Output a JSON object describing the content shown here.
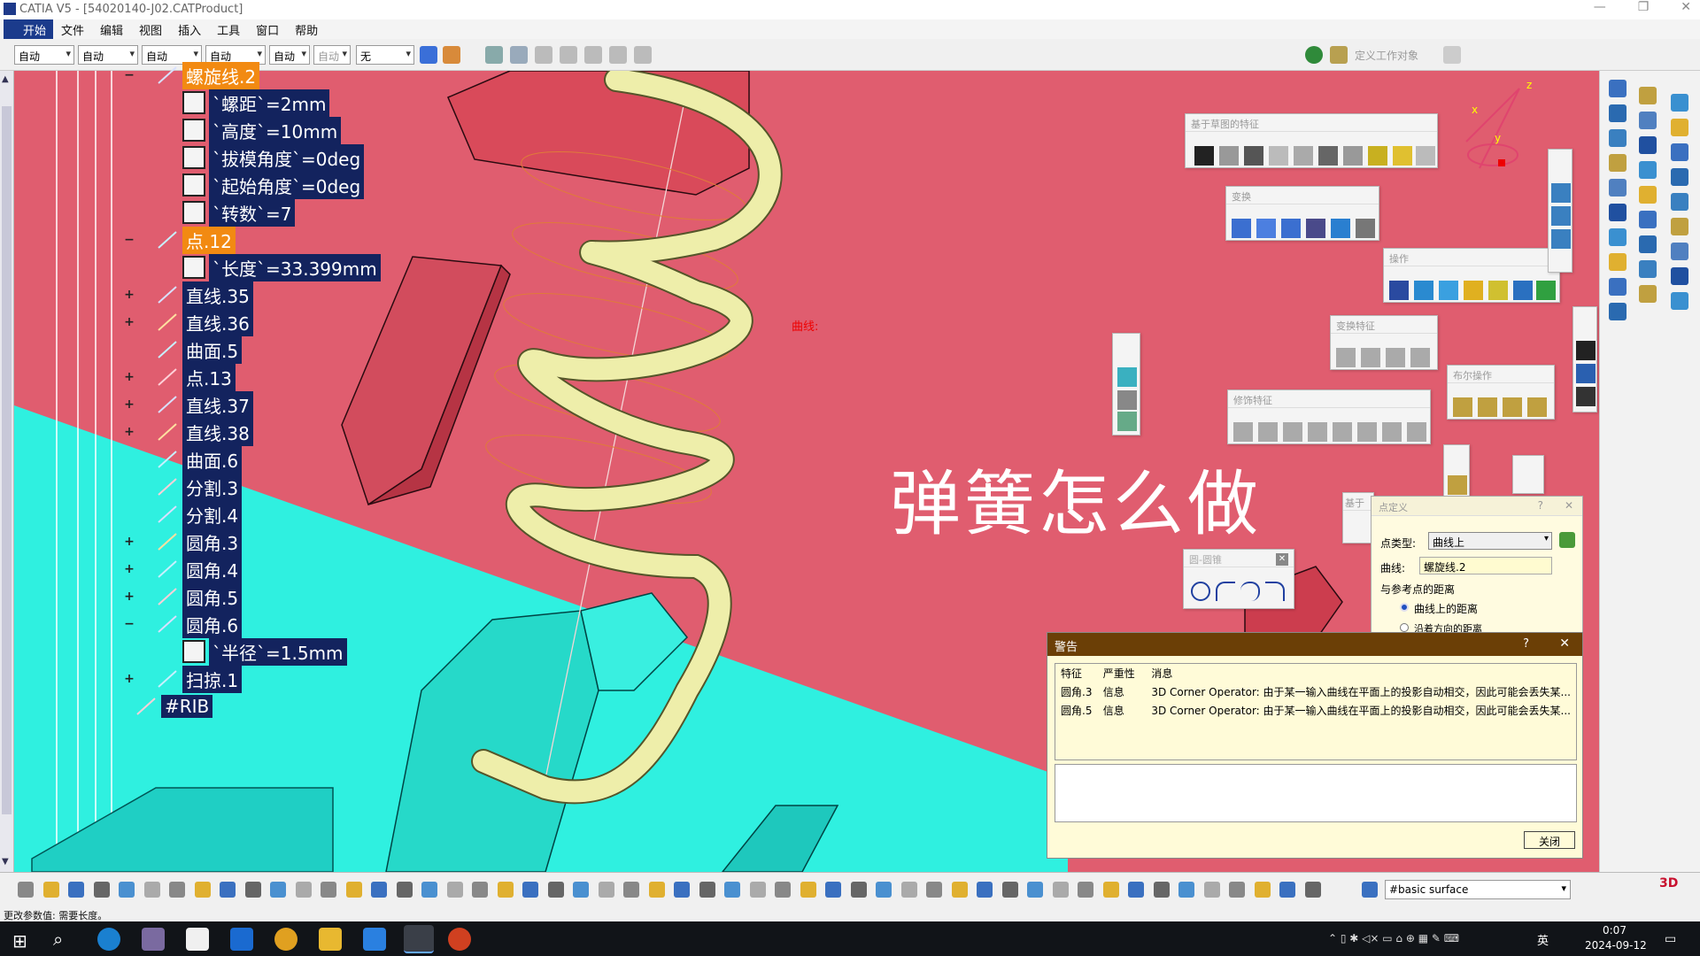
{
  "window": {
    "title": "CATIA V5 - [54020140-J02.CATProduct]",
    "controls": [
      "—",
      "❐",
      "✕"
    ]
  },
  "menu": [
    "开始",
    "文件",
    "编辑",
    "视图",
    "插入",
    "工具",
    "窗口",
    "帮助"
  ],
  "toolbar": {
    "combos": [
      "自动",
      "自动",
      "自动",
      "自动",
      "自动",
      "自动",
      "无"
    ],
    "define_work_object": "定义工作对象"
  },
  "tree": {
    "nodes": [
      {
        "label": "螺旋线.2",
        "expander": "−",
        "selected": true,
        "indent": 0
      },
      {
        "label": "`螺距`=2mm",
        "expander": "",
        "indent": 1
      },
      {
        "label": "`高度`=10mm",
        "expander": "",
        "indent": 1
      },
      {
        "label": "`拔模角度`=0deg",
        "expander": "",
        "indent": 1
      },
      {
        "label": "`起始角度`=0deg",
        "expander": "",
        "indent": 1
      },
      {
        "label": "`转数`=7",
        "expander": "",
        "indent": 1
      },
      {
        "label": "点.12",
        "expander": "−",
        "selected": true,
        "indent": 0
      },
      {
        "label": "`长度`=33.399mm",
        "expander": "",
        "indent": 1
      },
      {
        "label": "直线.35",
        "expander": "+",
        "indent": 0
      },
      {
        "label": "直线.36",
        "expander": "+",
        "indent": 0
      },
      {
        "label": "曲面.5",
        "expander": "",
        "indent": 0
      },
      {
        "label": "点.13",
        "expander": "+",
        "indent": 0
      },
      {
        "label": "直线.37",
        "expander": "+",
        "indent": 0
      },
      {
        "label": "直线.38",
        "expander": "+",
        "indent": 0
      },
      {
        "label": "曲面.6",
        "expander": "",
        "indent": 0
      },
      {
        "label": "分割.3",
        "expander": "",
        "indent": 0
      },
      {
        "label": "分割.4",
        "expander": "",
        "indent": 0
      },
      {
        "label": "圆角.3",
        "expander": "+",
        "indent": 0
      },
      {
        "label": "圆角.4",
        "expander": "+",
        "indent": 0
      },
      {
        "label": "圆角.5",
        "expander": "+",
        "indent": 0
      },
      {
        "label": "圆角.6",
        "expander": "−",
        "indent": 0
      },
      {
        "label": "`半径`=1.5mm",
        "expander": "",
        "indent": 1
      },
      {
        "label": "扫掠.1",
        "expander": "+",
        "indent": 0
      },
      {
        "label": "#RIB",
        "expander": "",
        "indent": -1
      }
    ]
  },
  "viewport": {
    "overlay_text": "弹簧怎么做",
    "curve_label": "曲线:"
  },
  "panels": {
    "sketch_features": "基于草图的特征",
    "transform": "变换",
    "operations": "操作",
    "transform_features": "变换特征",
    "boolean_ops": "布尔操作",
    "dress_up": "修饰特征",
    "circle_conic": "圆-圆锥",
    "based_on": "基于"
  },
  "point_dialog": {
    "title": "点定义",
    "point_type_label": "点类型:",
    "point_type_value": "曲线上",
    "curve_label": "曲线:",
    "curve_value": "螺旋线.2",
    "distance_label": "与参考点的距离",
    "radio1": "曲线上的距离",
    "radio2": "沿着方向的距离"
  },
  "warning_dialog": {
    "title": "警告",
    "help": "?",
    "close_x": "✕",
    "columns": [
      "特征",
      "严重性",
      "消息"
    ],
    "rows": [
      [
        "圆角.3",
        "信息",
        "3D Corner Operator:  由于某一输入曲线在平面上的投影自动相交，因此可能会丢失某..."
      ],
      [
        "圆角.5",
        "信息",
        "3D Corner Operator:  由于某一输入曲线在平面上的投影自动相交，因此可能会丢失某..."
      ]
    ],
    "close_button": "关闭"
  },
  "bottom_toolbar": {
    "layer_value": "#basic surface"
  },
  "status_bar": {
    "text": "更改参数值: 需要长度。"
  },
  "taskbar": {
    "time": "0:07",
    "date": "2024-09-12",
    "ime": "英"
  },
  "colors": {
    "background_pink": "#e05d6f",
    "floor_cyan": "#2ff0e0",
    "spring_yellow": "#eeeeaa",
    "tree_label_bg": "#13235e",
    "selected_orange": "#f28a12",
    "warning_header": "#6b3f06"
  }
}
